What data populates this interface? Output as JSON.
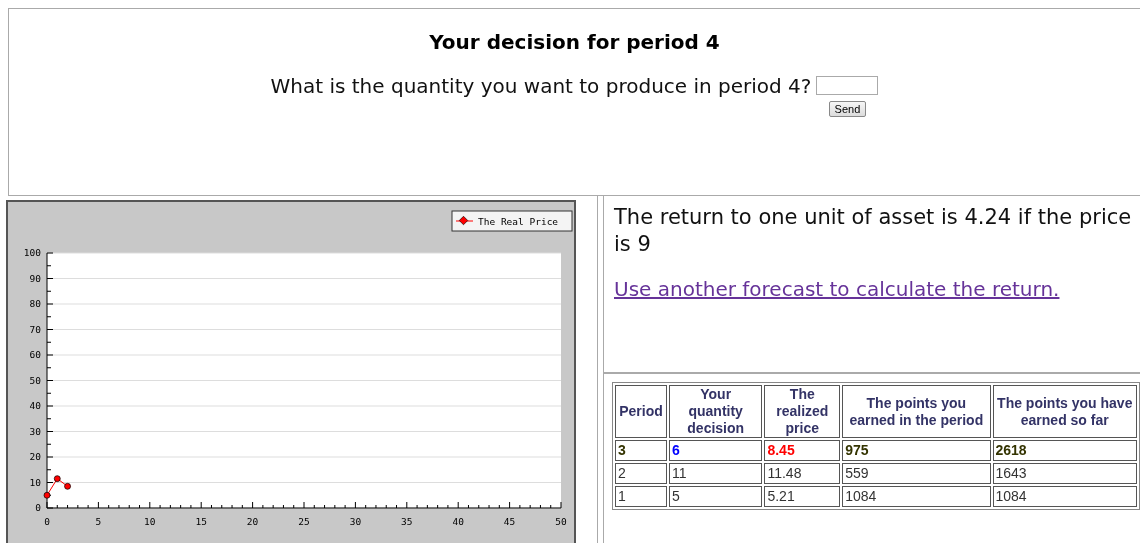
{
  "decision": {
    "title": "Your decision for period 4",
    "question": "What is the quantity you want to produce in period 4?",
    "send_button": "Send"
  },
  "chart": {
    "chart_data": {
      "type": "line",
      "x": [
        0,
        1,
        2
      ],
      "grid": true,
      "series": [
        {
          "name": "The Real Price",
          "color": "#ff0000",
          "marker": "circle",
          "values": [
            5,
            11.5,
            8.5
          ]
        }
      ],
      "xlim": [
        0,
        50
      ],
      "ylim": [
        0,
        100
      ],
      "xticks": [
        0,
        5,
        10,
        15,
        20,
        25,
        30,
        35,
        40,
        45,
        50
      ],
      "yticks": [
        0,
        10,
        20,
        30,
        40,
        50,
        60,
        70,
        80,
        90,
        100
      ]
    }
  },
  "info": {
    "text": "The return to one unit of asset is 4.24 if the price is 9",
    "link": "Use another forecast to calculate the return."
  },
  "table": {
    "columns": [
      "Period",
      "Your quantity decision",
      "The realized price",
      "The points you earned in the period",
      "The points you have earned so far"
    ],
    "rows": [
      {
        "highlighted": true,
        "cells": [
          {
            "text": "3",
            "color": "#333300"
          },
          {
            "text": "6",
            "color": "#0000ff"
          },
          {
            "text": "8.45",
            "color": "#ff0000"
          },
          {
            "text": "975",
            "color": "#333300"
          },
          {
            "text": "2618",
            "color": "#333300"
          }
        ]
      },
      {
        "highlighted": false,
        "cells": [
          {
            "text": "2",
            "color": "#333333"
          },
          {
            "text": "11",
            "color": "#333333"
          },
          {
            "text": "11.48",
            "color": "#333333"
          },
          {
            "text": "559",
            "color": "#333333"
          },
          {
            "text": "1643",
            "color": "#333333"
          }
        ]
      },
      {
        "highlighted": false,
        "cells": [
          {
            "text": "1",
            "color": "#333333"
          },
          {
            "text": "5",
            "color": "#333333"
          },
          {
            "text": "5.21",
            "color": "#333333"
          },
          {
            "text": "1084",
            "color": "#333333"
          },
          {
            "text": "1084",
            "color": "#333333"
          }
        ]
      }
    ]
  }
}
